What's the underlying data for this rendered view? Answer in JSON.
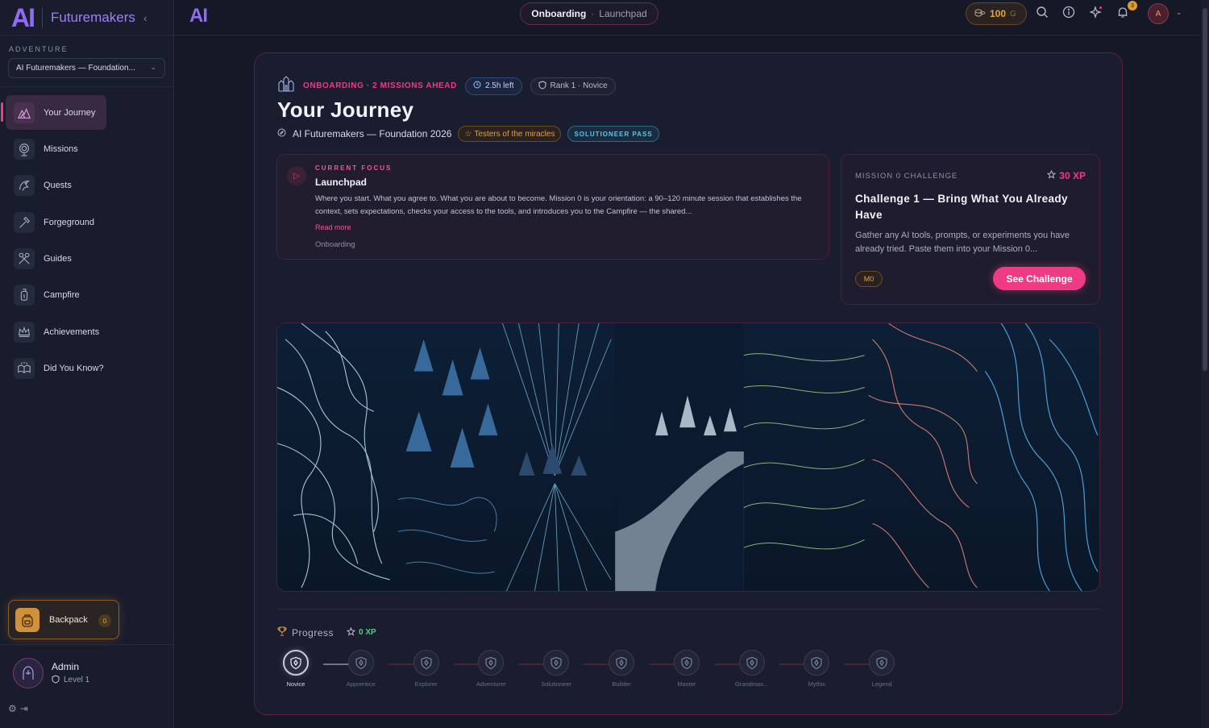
{
  "brand": {
    "logo": "AI",
    "name": "Futuremakers"
  },
  "sidebar": {
    "adventure_label": "ADVENTURE",
    "adventure_value": "AI Futuremakers — Foundation...",
    "items": [
      {
        "label": "Your Journey",
        "icon": "mountain-icon",
        "active": true
      },
      {
        "label": "Missions",
        "icon": "target-icon"
      },
      {
        "label": "Quests",
        "icon": "dragon-icon"
      },
      {
        "label": "Forgeground",
        "icon": "hammer-icon"
      },
      {
        "label": "Guides",
        "icon": "tools-icon"
      },
      {
        "label": "Campfire",
        "icon": "lantern-icon"
      },
      {
        "label": "Achievements",
        "icon": "crown-icon"
      },
      {
        "label": "Did You Know?",
        "icon": "book-icon"
      }
    ],
    "backpack": {
      "label": "Backpack",
      "count": "0"
    },
    "user": {
      "name": "Admin",
      "level": "Level 1"
    }
  },
  "topbar": {
    "logo": "AI",
    "breadcrumb_phase": "Onboarding",
    "breadcrumb_sep": "·",
    "breadcrumb_mission": "Launchpad",
    "coins": "100",
    "coins_unit": "G",
    "notifications": "3",
    "avatar_initial": "A"
  },
  "main": {
    "phase_label": "ONBOARDING · 2 MISSIONS AHEAD",
    "time_left": "2.5h left",
    "rank": "Rank 1 · Novice",
    "title": "Your Journey",
    "program": "AI Futuremakers — Foundation 2026",
    "testers_chip": "Testers of the miracles",
    "pass_chip": "SOLUTIONEER PASS",
    "focus": {
      "label": "CURRENT FOCUS",
      "title": "Launchpad",
      "description": "Where you start. What you agree to. What you are about to become. Mission 0 is your orientation: a 90–120 minute session that establishes the context, sets expectations, checks your access to the tools, and introduces you to the Campfire — the shared...",
      "read_more": "Read more",
      "tag": "Onboarding"
    },
    "challenge": {
      "label": "MISSION 0 CHALLENGE",
      "xp": "30 XP",
      "title": "Challenge 1 — Bring What You Already Have",
      "description": "Gather any AI tools, prompts, or experiments you have already tried. Paste them into your Mission 0...",
      "badge": "M0",
      "button": "See Challenge"
    },
    "progress": {
      "label": "Progress",
      "xp": "0 XP",
      "ranks": [
        "Novice",
        "Apprentice",
        "Explorer",
        "Adventurer",
        "Solutioneer",
        "Builder",
        "Master",
        "Grandmas...",
        "Mythic",
        "Legend"
      ],
      "current_index": 0
    }
  },
  "colors": {
    "accent": "#ef3b83",
    "brand": "#8f6cf2",
    "gold": "#e9a53a",
    "xp_green": "#4ad27a"
  }
}
